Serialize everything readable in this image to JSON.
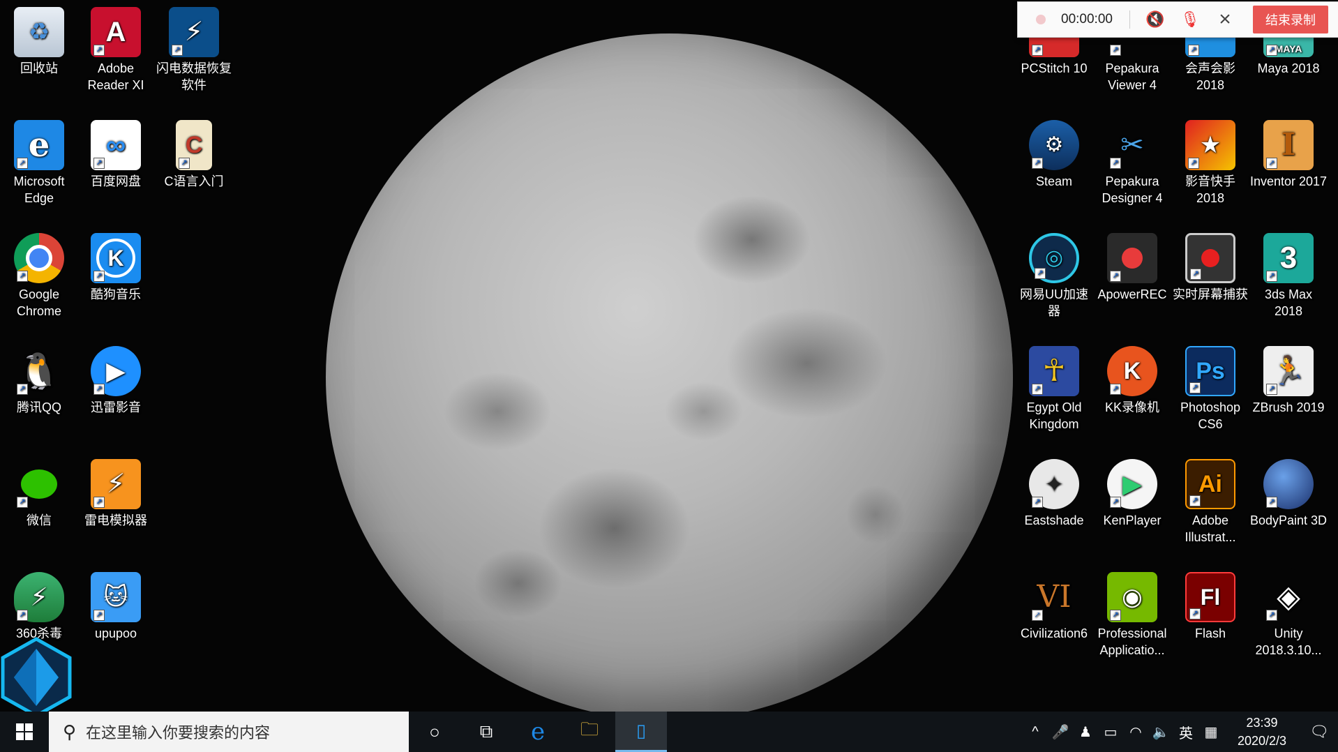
{
  "desktop_icons": {
    "recycle_bin": "回收站",
    "adobe_reader": "Adobe Reader XI",
    "data_recovery": "闪电数据恢复软件",
    "edge": "Microsoft Edge",
    "baidu_pan": "百度网盘",
    "c_lang": "C语言入门",
    "chrome": "Google Chrome",
    "kugou": "酷狗音乐",
    "qq": "腾讯QQ",
    "xunlei": "迅雷影音",
    "wechat": "微信",
    "leidian": "雷电模拟器",
    "antivirus_360": "360杀毒",
    "upupoo": "upupoo",
    "pcstitch": "PCStitch 10",
    "pepakura_viewer": "Pepakura Viewer 4",
    "huisheng": "会声会影 2018",
    "maya": "Maya 2018",
    "steam": "Steam",
    "pepakura_designer": "Pepakura Designer 4",
    "yingyin": "影音快手 2018",
    "inventor": "Inventor 2017",
    "uu": "网易UU加速器",
    "apowerrec": "ApowerREC",
    "screen_capture": "实时屏幕捕获",
    "max3ds": "3ds Max 2018",
    "egypt": "Egypt Old Kingdom",
    "kk": "KK录像机",
    "photoshop": "Photoshop CS6",
    "zbrush": "ZBrush 2019",
    "eastshade": "Eastshade",
    "kenplayer": "KenPlayer",
    "illustrator": "Adobe Illustrat...",
    "bodypaint": "BodyPaint 3D",
    "civ6": "Civilization6",
    "nvidia": "Professional Applicatio...",
    "flash": "Flash",
    "unity": "Unity 2018.3.10..."
  },
  "recorder": {
    "timer": "00:00:00",
    "stop_label": "结束录制"
  },
  "taskbar": {
    "search_placeholder": "在这里输入你要搜索的内容",
    "ime": "英",
    "time": "23:39",
    "date": "2020/2/3"
  },
  "colors": {
    "taskbar_bg": "#101418",
    "stop_button": "#e85552",
    "accent": "#76b9ed"
  }
}
